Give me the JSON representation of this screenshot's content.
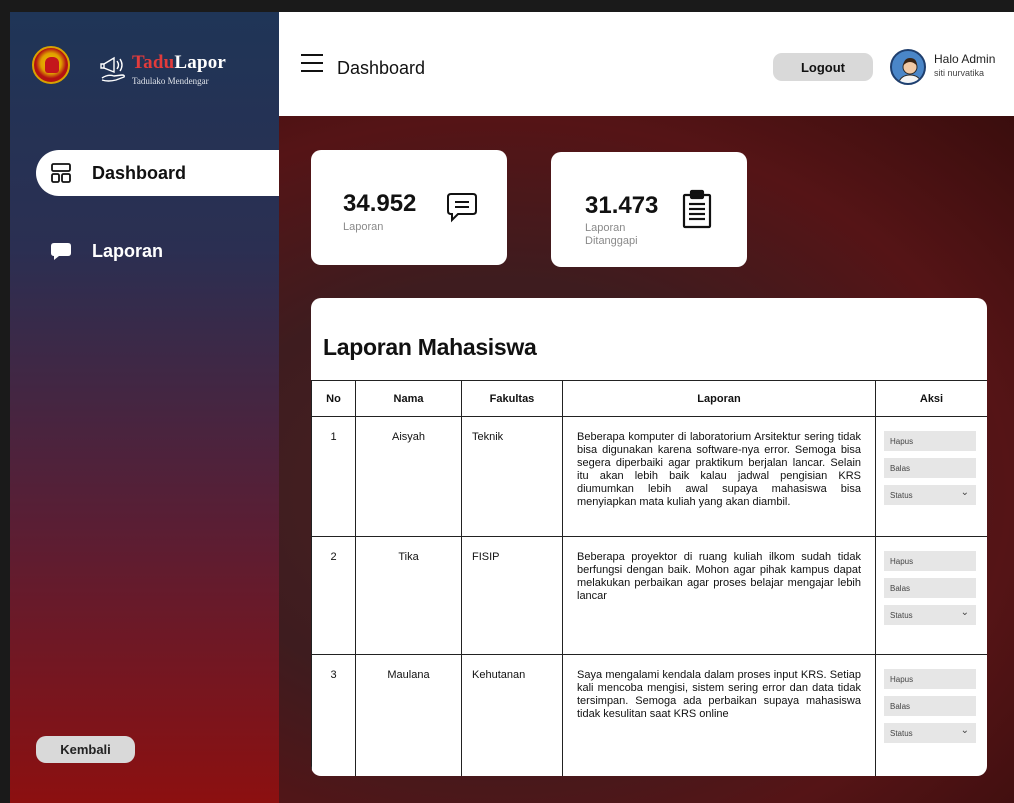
{
  "brand": {
    "title_part1": "Tadu",
    "title_part2": "Lapor",
    "subtitle": "Tadulako Mendengar"
  },
  "sidebar": {
    "items": [
      {
        "label": "Dashboard",
        "icon": "dashboard-icon",
        "active": true
      },
      {
        "label": "Laporan",
        "icon": "chat-bubble-icon",
        "active": false
      }
    ],
    "back_label": "Kembali"
  },
  "header": {
    "title": "Dashboard",
    "logout_label": "Logout",
    "greeting": "Halo Admin",
    "username": "siti nurvatika"
  },
  "stats": [
    {
      "value": "34.952",
      "label": "Laporan",
      "icon": "message-icon"
    },
    {
      "value": "31.473",
      "label_line1": "Laporan",
      "label_line2": "Ditanggapi",
      "icon": "clipboard-icon"
    }
  ],
  "table": {
    "title": "Laporan Mahasiswa",
    "columns": [
      "No",
      "Nama",
      "Fakultas",
      "Laporan",
      "Aksi"
    ],
    "actions": {
      "delete": "Hapus",
      "reply": "Balas",
      "status": "Status"
    },
    "rows": [
      {
        "no": "1",
        "nama": "Aisyah",
        "fakultas": "Teknik",
        "laporan": "Beberapa komputer di laboratorium Arsitektur sering tidak bisa digunakan karena software-nya error. Semoga bisa segera diperbaiki agar praktikum berjalan lancar. Selain itu akan lebih baik kalau jadwal pengisian KRS diumumkan lebih awal supaya mahasiswa bisa menyiapkan mata kuliah yang akan diambil."
      },
      {
        "no": "2",
        "nama": "Tika",
        "fakultas": "FISIP",
        "laporan": "Beberapa proyektor di ruang kuliah ilkom sudah tidak berfungsi dengan baik. Mohon agar pihak kampus dapat melakukan perbaikan agar proses belajar mengajar lebih lancar"
      },
      {
        "no": "3",
        "nama": "Maulana",
        "fakultas": "Kehutanan",
        "laporan": "Saya mengalami kendala dalam proses input KRS. Setiap kali mencoba mengisi, sistem sering error dan data tidak tersimpan. Semoga ada perbaikan supaya mahasiswa tidak kesulitan saat KRS online"
      }
    ]
  },
  "colors": {
    "sidebar_top": "#1f3557",
    "sidebar_bottom": "#8c1010",
    "brand_accent": "#e23b3b",
    "button_gray": "#d9d9d9"
  }
}
